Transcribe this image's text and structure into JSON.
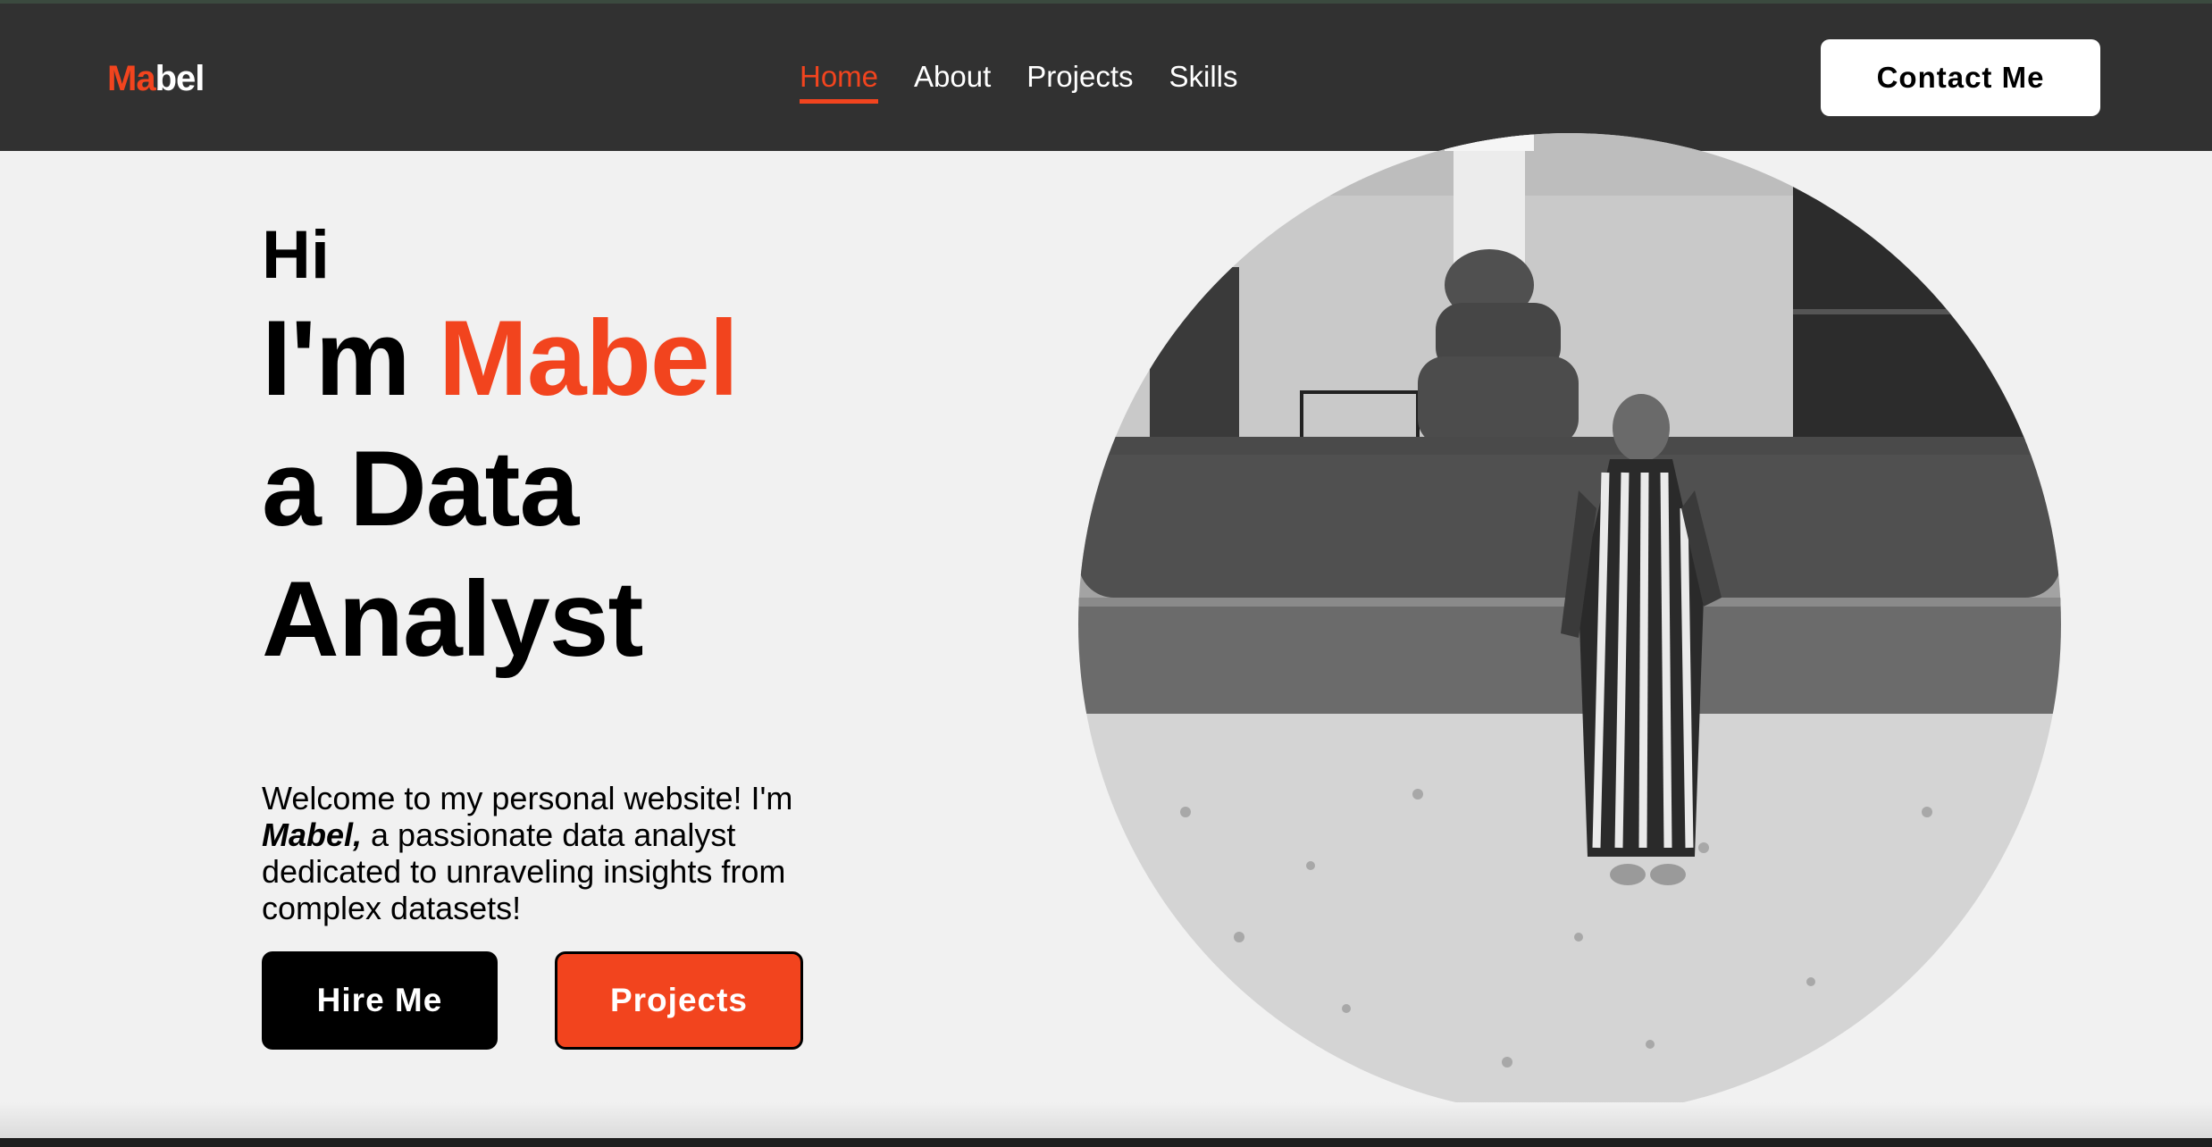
{
  "nav": {
    "logo_accent": "Ma",
    "logo_rest": "bel",
    "links": [
      {
        "label": "Home",
        "active": true
      },
      {
        "label": "About",
        "active": false
      },
      {
        "label": "Projects",
        "active": false
      },
      {
        "label": "Skills",
        "active": false
      }
    ],
    "contact_label": "Contact Me"
  },
  "hero": {
    "greeting": "Hi",
    "line1_prefix": "I'm ",
    "name": "Mabel",
    "line2": "a Data",
    "line3": "Analyst",
    "intro_part1": "Welcome to my personal website! I'm ",
    "intro_name": "Mabel,",
    "intro_part2": " a passionate data analyst dedicated to unraveling insights from complex datasets!",
    "hire_label": "Hire Me",
    "projects_label": "Projects"
  },
  "colors": {
    "accent": "#f2441e",
    "navbar": "#313131",
    "background": "#f1f1f1"
  }
}
